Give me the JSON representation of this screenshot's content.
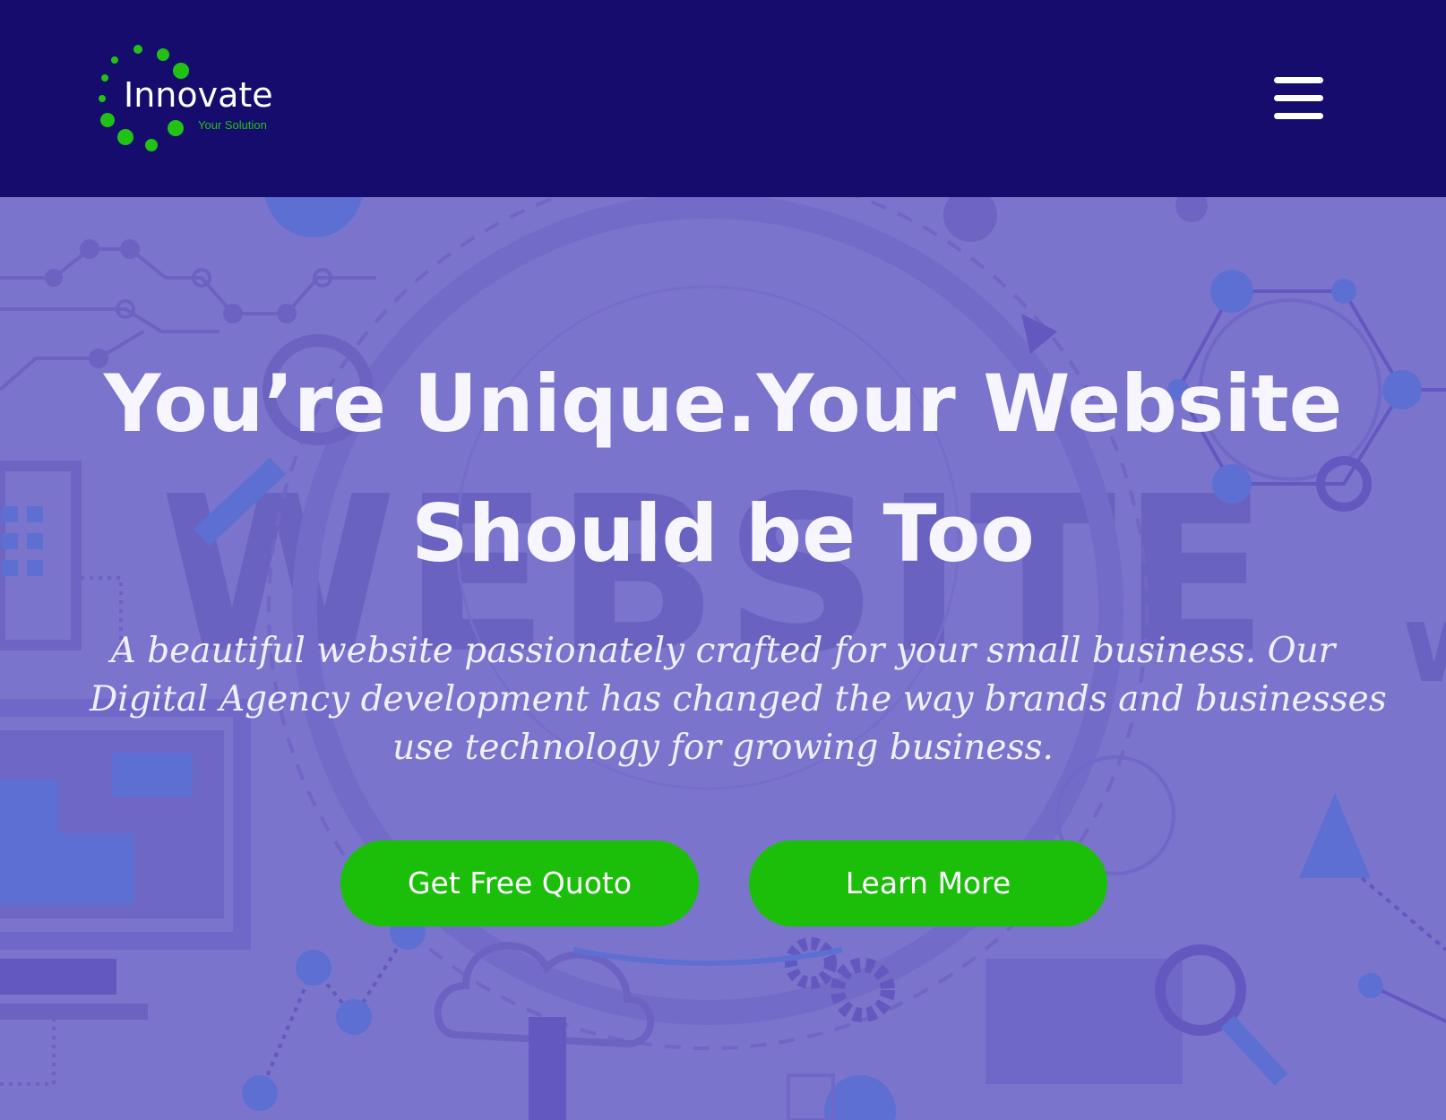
{
  "header": {
    "logo": {
      "name": "Innovate",
      "tagline": "Your Solution",
      "icon": "dotted-circle-logo"
    },
    "menu_icon": "hamburger-icon"
  },
  "hero": {
    "background_word": "WEBSITE",
    "background_url": "www",
    "title_lines": [
      "You’re Unique.Your Website",
      "Should be Too"
    ],
    "subtitle_lines": [
      "A beautiful website passionately crafted for your small business. Our",
      "Digital Agency development has changed the way brands and businesses",
      "use technology for growing business."
    ],
    "primary_button": "Get Free Quoto",
    "secondary_button": "Learn More"
  },
  "colors": {
    "header_bg": "#150c6e",
    "hero_bg": "#7b74cc",
    "accent_green": "#1bbf0a",
    "logo_green": "#22c214",
    "text_white": "#ffffff"
  }
}
